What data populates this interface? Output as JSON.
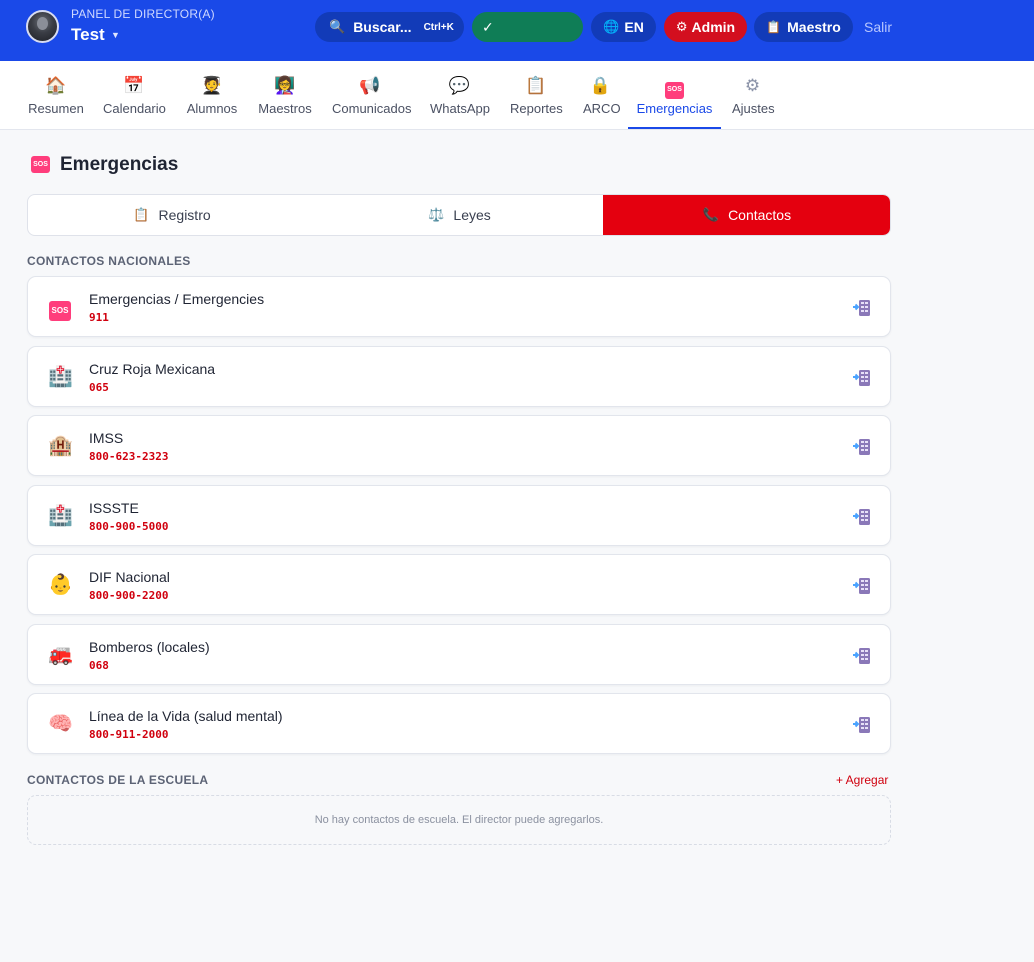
{
  "header": {
    "panel_title": "PANEL DE DIRECTOR(A)",
    "school_name": "Test",
    "search_label": "Buscar...",
    "search_shortcut": "Ctrl+K",
    "status_check": "✓",
    "lang_label": "EN",
    "admin_label": "Admin",
    "teacher_label": "Maestro",
    "logout_label": "Salir"
  },
  "nav": {
    "items": [
      {
        "label": "Resumen",
        "icon": "house-icon"
      },
      {
        "label": "Calendario",
        "icon": "calendar-icon"
      },
      {
        "label": "Alumnos",
        "icon": "student-icon"
      },
      {
        "label": "Maestros",
        "icon": "teacher-icon"
      },
      {
        "label": "Comunicados",
        "icon": "megaphone-icon"
      },
      {
        "label": "WhatsApp",
        "icon": "speech-bubble-icon"
      },
      {
        "label": "Reportes",
        "icon": "clipboard-icon"
      },
      {
        "label": "ARCO",
        "icon": "lock-icon"
      },
      {
        "label": "Emergencias",
        "icon": "sos-icon"
      },
      {
        "label": "Ajustes",
        "icon": "gear-icon"
      }
    ],
    "active": "Emergencias"
  },
  "page": {
    "title": "Emergencias",
    "sos_badge": "SOS"
  },
  "tabs": [
    {
      "label": "Registro",
      "icon": "clipboard-icon"
    },
    {
      "label": "Leyes",
      "icon": "scales-icon"
    },
    {
      "label": "Contactos",
      "icon": "phone-icon"
    }
  ],
  "active_tab": "Contactos",
  "national": {
    "label": "CONTACTOS NACIONALES",
    "contacts": [
      {
        "name": "Emergencias / Emergencies",
        "phone": "911",
        "icon": "sos-icon"
      },
      {
        "name": "Cruz Roja Mexicana",
        "phone": "065",
        "icon": "hospital-icon"
      },
      {
        "name": "IMSS",
        "phone": "800-623-2323",
        "icon": "hospital-building-icon"
      },
      {
        "name": "ISSSTE",
        "phone": "800-900-5000",
        "icon": "hospital-icon"
      },
      {
        "name": "DIF Nacional",
        "phone": "800-900-2200",
        "icon": "baby-icon"
      },
      {
        "name": "Bomberos (locales)",
        "phone": "068",
        "icon": "fire-engine-icon"
      },
      {
        "name": "Línea de la Vida (salud mental)",
        "phone": "800-911-2000",
        "icon": "brain-icon"
      }
    ]
  },
  "school": {
    "label": "CONTACTOS DE LA ESCUELA",
    "add_label": "+ Agregar",
    "empty_text": "No hay contactos de escuela. El director puede agregarlos."
  },
  "colors": {
    "header_blue": "#1a49e8",
    "accent_red": "#e4000f",
    "status_green": "#0f7d56"
  }
}
